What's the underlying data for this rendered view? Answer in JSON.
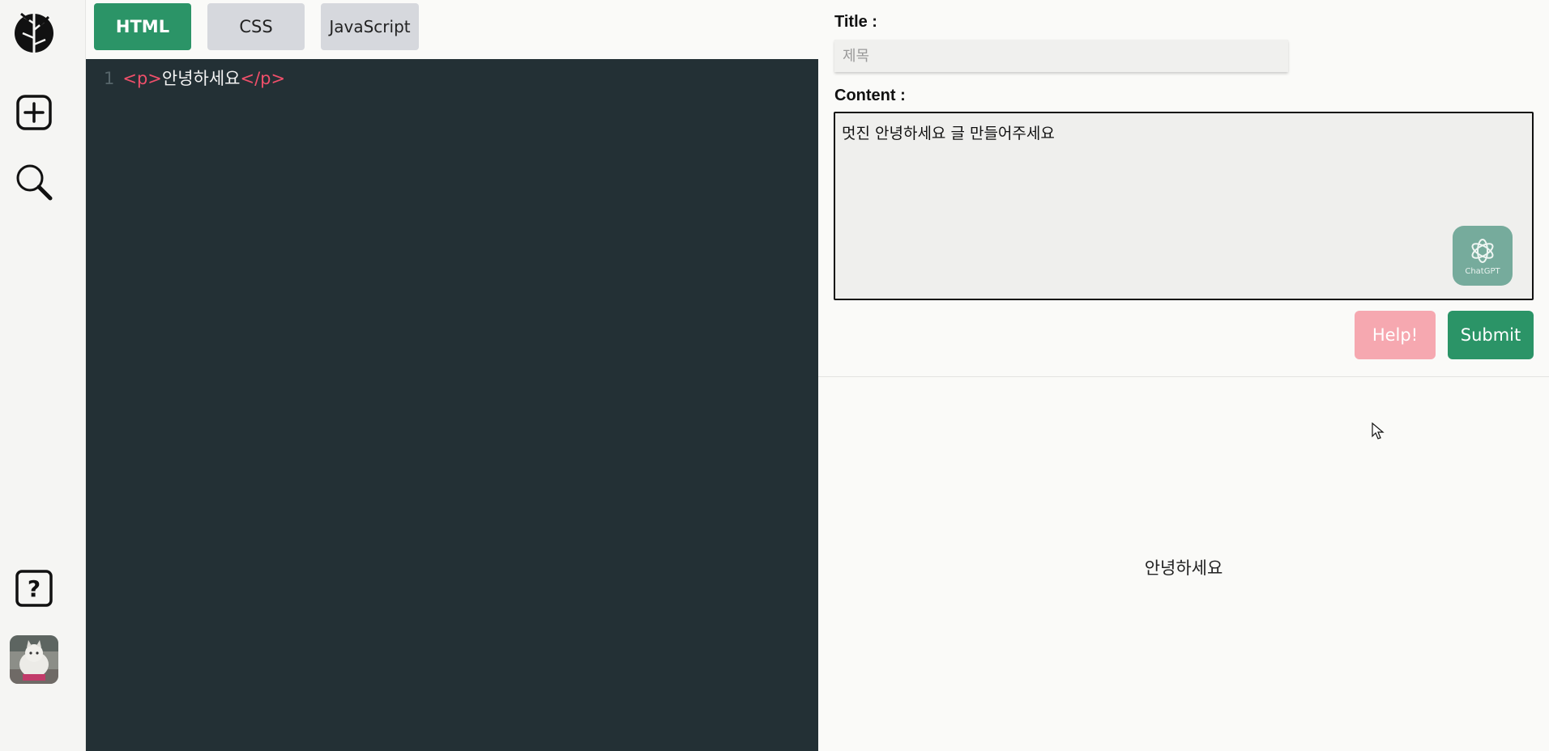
{
  "sidebar": {
    "logo_icon": "bamboo-logo-icon",
    "add_icon": "plus-square-icon",
    "search_icon": "search-icon",
    "help_icon": "question-square-icon",
    "avatar_icon": "cat-avatar"
  },
  "tabs": {
    "html": "HTML",
    "css": "CSS",
    "javascript": "JavaScript"
  },
  "editor": {
    "line_number": "1",
    "open_tag": "<p>",
    "content": "안녕하세요",
    "close_tag": "</p>"
  },
  "form": {
    "title_label": "Title :",
    "title_placeholder": "제목",
    "title_value": "",
    "content_label": "Content :",
    "content_value": "멋진 안녕하세요 글 만들어주세요",
    "gpt_label": "ChatGPT",
    "help_button": "Help!",
    "submit_button": "Submit"
  },
  "preview": {
    "text": "안녕하세요"
  },
  "colors": {
    "accent_green": "#2b9467",
    "help_pink": "#f6a8b0",
    "editor_bg": "#233035",
    "tag_red": "#ef4f6a"
  }
}
